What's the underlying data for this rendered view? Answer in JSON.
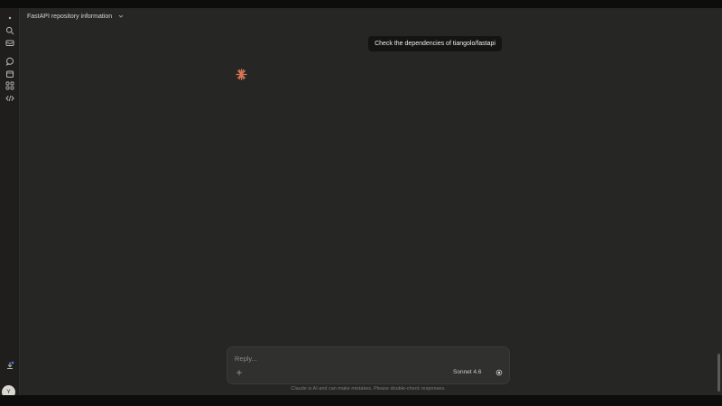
{
  "header": {
    "title": "FastAPI repository information"
  },
  "chat": {
    "user_message": "Check the dependencies of tiangolo/fastapi"
  },
  "composer": {
    "placeholder": "Reply...",
    "model": "Sonnet 4.6"
  },
  "footer": {
    "disclaimer": "Claude is AI and can make mistakes. Please double-check responses."
  },
  "user": {
    "avatar_initial": "Y"
  },
  "colors": {
    "accent": "#d97757",
    "background": "#262624",
    "bubble": "#141413"
  }
}
